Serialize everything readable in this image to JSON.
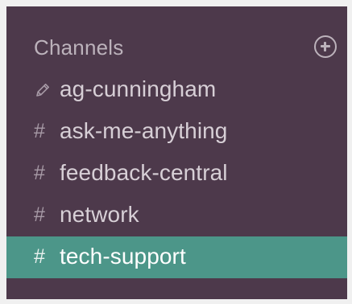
{
  "sidebar": {
    "section_title": "Channels",
    "add_icon": "plus-circle-icon",
    "channels": [
      {
        "prefix_icon": "pencil-icon",
        "prefix": "",
        "name": "ag-cunningham",
        "active": false
      },
      {
        "prefix_icon": "hash-icon",
        "prefix": "#",
        "name": "ask-me-anything",
        "active": false
      },
      {
        "prefix_icon": "hash-icon",
        "prefix": "#",
        "name": "feedback-central",
        "active": false
      },
      {
        "prefix_icon": "hash-icon",
        "prefix": "#",
        "name": "network",
        "active": false
      },
      {
        "prefix_icon": "hash-icon",
        "prefix": "#",
        "name": "tech-support",
        "active": true
      }
    ]
  },
  "colors": {
    "sidebar_bg": "#4d394b",
    "active_bg": "#4c9689",
    "text": "#d7cfd6",
    "muted_text": "#bcb2bb"
  }
}
